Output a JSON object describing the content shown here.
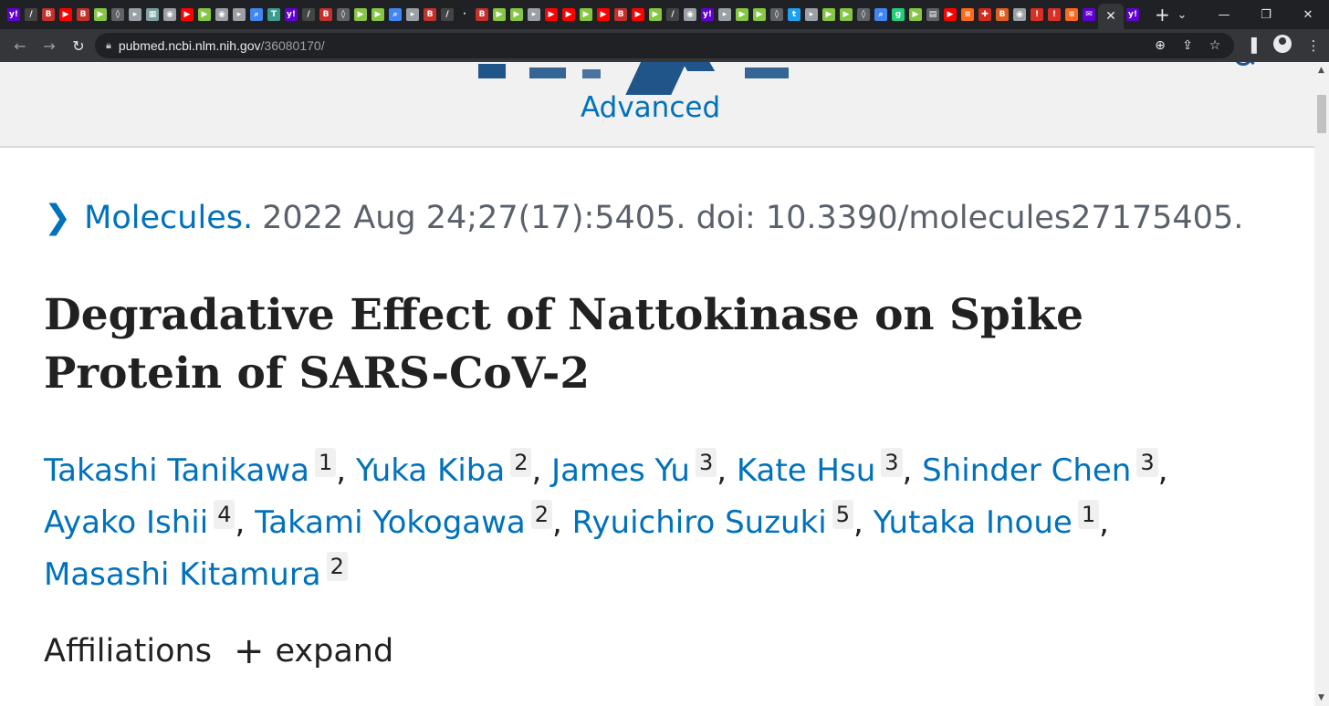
{
  "browser": {
    "tab_favicons": [
      {
        "icon": "yahoo-icon",
        "glyph": "y!",
        "color": "#6001d2"
      },
      {
        "icon": "substack-icon",
        "glyph": "/",
        "color": "#444444"
      },
      {
        "icon": "bi-icon",
        "glyph": "B",
        "color": "#c4302b"
      },
      {
        "icon": "youtube-icon",
        "glyph": "▶",
        "color": "#ff0000"
      },
      {
        "icon": "bi-icon",
        "glyph": "B",
        "color": "#c4302b"
      },
      {
        "icon": "rumble-icon",
        "glyph": "▶",
        "color": "#85c742"
      },
      {
        "icon": "shield-icon",
        "glyph": "◊",
        "color": "#5f6368"
      },
      {
        "icon": "page-icon",
        "glyph": "▸",
        "color": "#9aa0a6"
      },
      {
        "icon": "image-icon",
        "glyph": "▦",
        "color": "#7fa0a0"
      },
      {
        "icon": "globe-icon",
        "glyph": "◉",
        "color": "#9aa0a6"
      },
      {
        "icon": "youtube-icon",
        "glyph": "▶",
        "color": "#ff0000"
      },
      {
        "icon": "rumble-icon",
        "glyph": "▶",
        "color": "#85c742"
      },
      {
        "icon": "globe-icon",
        "glyph": "◉",
        "color": "#9aa0a6"
      },
      {
        "icon": "page-icon",
        "glyph": "▸",
        "color": "#9aa0a6"
      },
      {
        "icon": "search-icon",
        "glyph": "⌕",
        "color": "#4285f4"
      },
      {
        "icon": "site-icon",
        "glyph": "T",
        "color": "#3a9d8f"
      },
      {
        "icon": "yahoo-icon",
        "glyph": "y!",
        "color": "#6001d2"
      },
      {
        "icon": "substack-icon",
        "glyph": "/",
        "color": "#444444"
      },
      {
        "icon": "bi-icon",
        "glyph": "B",
        "color": "#c4302b"
      },
      {
        "icon": "shield-icon",
        "glyph": "◊",
        "color": "#5f6368"
      },
      {
        "icon": "rumble-icon",
        "glyph": "▶",
        "color": "#85c742"
      },
      {
        "icon": "rumble-icon",
        "glyph": "▶",
        "color": "#85c742"
      },
      {
        "icon": "search-icon",
        "glyph": "⌕",
        "color": "#4285f4"
      },
      {
        "icon": "page-icon",
        "glyph": "▸",
        "color": "#9aa0a6"
      },
      {
        "icon": "bi-icon",
        "glyph": "B",
        "color": "#c4302b"
      },
      {
        "icon": "substack-icon",
        "glyph": "/",
        "color": "#444444"
      },
      {
        "icon": "blank-icon",
        "glyph": "·",
        "color": "#202124"
      },
      {
        "icon": "bi-icon",
        "glyph": "B",
        "color": "#c4302b"
      },
      {
        "icon": "rumble-icon",
        "glyph": "▶",
        "color": "#85c742"
      },
      {
        "icon": "rumble-icon",
        "glyph": "▶",
        "color": "#85c742"
      },
      {
        "icon": "page-icon",
        "glyph": "▸",
        "color": "#9aa0a6"
      },
      {
        "icon": "youtube-icon",
        "glyph": "▶",
        "color": "#ff0000"
      },
      {
        "icon": "youtube-icon",
        "glyph": "▶",
        "color": "#ff0000"
      },
      {
        "icon": "rumble-icon",
        "glyph": "▶",
        "color": "#85c742"
      },
      {
        "icon": "youtube-icon",
        "glyph": "▶",
        "color": "#ff0000"
      },
      {
        "icon": "bi-icon",
        "glyph": "B",
        "color": "#c4302b"
      },
      {
        "icon": "youtube-icon",
        "glyph": "▶",
        "color": "#ff0000"
      },
      {
        "icon": "rumble-icon",
        "glyph": "▶",
        "color": "#85c742"
      },
      {
        "icon": "substack-icon",
        "glyph": "/",
        "color": "#444444"
      },
      {
        "icon": "globe-icon",
        "glyph": "◉",
        "color": "#9aa0a6"
      },
      {
        "icon": "yahoo-icon",
        "glyph": "y!",
        "color": "#6001d2"
      },
      {
        "icon": "page-icon",
        "glyph": "▸",
        "color": "#9aa0a6"
      },
      {
        "icon": "rumble-icon",
        "glyph": "▶",
        "color": "#85c742"
      },
      {
        "icon": "rumble-icon",
        "glyph": "▶",
        "color": "#85c742"
      },
      {
        "icon": "shield-icon",
        "glyph": "◊",
        "color": "#5f6368"
      },
      {
        "icon": "twitter-icon",
        "glyph": "t",
        "color": "#1da1f2"
      },
      {
        "icon": "page-icon",
        "glyph": "▸",
        "color": "#9aa0a6"
      },
      {
        "icon": "rumble-icon",
        "glyph": "▶",
        "color": "#85c742"
      },
      {
        "icon": "rumble-icon",
        "glyph": "▶",
        "color": "#85c742"
      },
      {
        "icon": "shield-icon",
        "glyph": "◊",
        "color": "#5f6368"
      },
      {
        "icon": "search-icon",
        "glyph": "⌕",
        "color": "#4285f4"
      },
      {
        "icon": "gab-icon",
        "glyph": "g",
        "color": "#21cf7a"
      },
      {
        "icon": "rumble-icon",
        "glyph": "▶",
        "color": "#85c742"
      },
      {
        "icon": "news-icon",
        "glyph": "▤",
        "color": "#5f6368"
      },
      {
        "icon": "youtube-icon",
        "glyph": "▶",
        "color": "#ff0000"
      },
      {
        "icon": "bookmark-icon",
        "glyph": "≡",
        "color": "#ff6719"
      },
      {
        "icon": "flag-icon",
        "glyph": "✚",
        "color": "#d52b1e"
      },
      {
        "icon": "bi-icon",
        "glyph": "B",
        "color": "#e05f1f"
      },
      {
        "icon": "globe-icon",
        "glyph": "◉",
        "color": "#9aa0a6"
      },
      {
        "icon": "alert-icon",
        "glyph": "!",
        "color": "#d93025"
      },
      {
        "icon": "alert-icon",
        "glyph": "!",
        "color": "#d93025"
      },
      {
        "icon": "bookmark-icon",
        "glyph": "≡",
        "color": "#ff6719"
      },
      {
        "icon": "mail-icon",
        "glyph": "✉",
        "color": "#6001d2"
      }
    ],
    "active_tab_close": "✕",
    "trailing_tab": {
      "icon": "yahoo-icon",
      "glyph": "y!",
      "color": "#6001d2"
    },
    "new_tab": "+",
    "window_controls": {
      "dropdown": "⌄",
      "minimize": "—",
      "restore": "❐",
      "close": "✕"
    },
    "nav": {
      "back": "←",
      "forward": "→",
      "reload": "↻"
    },
    "url_host": "pubmed.ncbi.nlm.nih.gov",
    "url_path": "/36080170/",
    "omnibox_icons": {
      "zoom": "⊕",
      "share": "⇪",
      "bookmark": "☆"
    },
    "toolbar_icons": {
      "sidebar": "▐",
      "menu": "⋮"
    }
  },
  "header": {
    "advanced_link": "Advanced",
    "brand_color": "#20558a"
  },
  "article": {
    "citation": {
      "journal": "Molecules.",
      "details": "2022 Aug 24;27(17):5405. doi: 10.3390/molecules27175405."
    },
    "title": "Degradative Effect of Nattokinase on Spike Protein of SARS-CoV-2",
    "authors": [
      {
        "name": "Takashi Tanikawa",
        "aff": "1"
      },
      {
        "name": "Yuka Kiba",
        "aff": "2"
      },
      {
        "name": "James Yu",
        "aff": "3"
      },
      {
        "name": "Kate Hsu",
        "aff": "3"
      },
      {
        "name": "Shinder Chen",
        "aff": "3"
      },
      {
        "name": "Ayako Ishii",
        "aff": "4"
      },
      {
        "name": "Takami Yokogawa",
        "aff": "2"
      },
      {
        "name": "Ryuichiro Suzuki",
        "aff": "5"
      },
      {
        "name": "Yutaka Inoue",
        "aff": "1"
      },
      {
        "name": "Masashi Kitamura",
        "aff": "2"
      }
    ],
    "separator": ",",
    "affiliations_label": "Affiliations",
    "expand_icon": "+",
    "expand_label": "expand",
    "link_color": "#0071bc"
  }
}
